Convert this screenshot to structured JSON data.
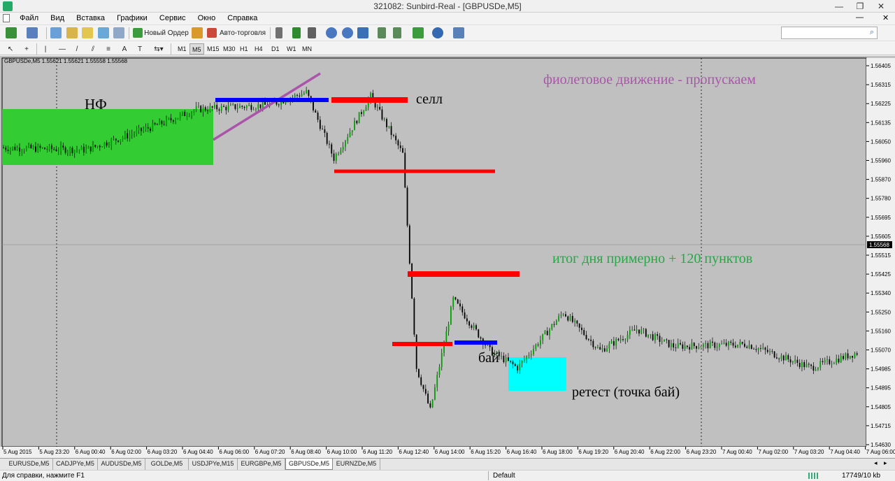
{
  "window": {
    "title": "321082: Sunbird-Real - [GBPUSDe,M5]",
    "minimize": "—",
    "restore": "❐",
    "close": "✕"
  },
  "menu": [
    "Файл",
    "Вид",
    "Вставка",
    "Графики",
    "Сервис",
    "Окно",
    "Справка"
  ],
  "toolbar": {
    "new_order": "Новый Ордер",
    "autotrading": "Авто-торговля",
    "search_placeholder": ""
  },
  "timeframes": [
    "M1",
    "M5",
    "M15",
    "M30",
    "H1",
    "H4",
    "D1",
    "W1",
    "MN"
  ],
  "active_timeframe": "M5",
  "chart": {
    "header": "GBPUSDe,M5  1.55621 1.55621 1.55558 1.55568",
    "current_price": "1.55568",
    "price_ticks": [
      "1.56405",
      "1.56315",
      "1.56225",
      "1.56135",
      "1.56050",
      "1.55960",
      "1.55870",
      "1.55780",
      "1.55695",
      "1.55605",
      "1.55515",
      "1.55425",
      "1.55340",
      "1.55250",
      "1.55160",
      "1.55070",
      "1.54985",
      "1.54895",
      "1.54805",
      "1.54715",
      "1.54630"
    ],
    "time_ticks": [
      "5 Aug 2015",
      "5 Aug 23:20",
      "6 Aug 00:40",
      "6 Aug 02:00",
      "6 Aug 03:20",
      "6 Aug 04:40",
      "6 Aug 06:00",
      "6 Aug 07:20",
      "6 Aug 08:40",
      "6 Aug 10:00",
      "6 Aug 11:20",
      "6 Aug 12:40",
      "6 Aug 14:00",
      "6 Aug 15:20",
      "6 Aug 16:40",
      "6 Aug 18:00",
      "6 Aug 19:20",
      "6 Aug 20:40",
      "6 Aug 22:00",
      "6 Aug 23:20",
      "7 Aug 00:40",
      "7 Aug 02:00",
      "7 Aug 03:20",
      "7 Aug 04:40",
      "7 Aug 06:00"
    ],
    "annotations": {
      "nf": "НФ",
      "sell": "селл",
      "buy": "бай",
      "violet": "фиолетовое движение - пропускаем",
      "result": "итог дня примерно + 120 пунктов",
      "retest": "ретест (точка бай)"
    },
    "colors": {
      "background": "#c0c0c0",
      "bull": "#00a000",
      "bear": "#000000",
      "nf_zone": "#33cc33",
      "retest_zone": "#00ffff",
      "level_red": "#ff0000",
      "level_blue": "#0000ff",
      "violet": "#aa55aa",
      "result_text": "#22aa44"
    }
  },
  "chart_data": {
    "type": "candlestick",
    "symbol": "GBPUSDe",
    "timeframe": "M5",
    "ylim": [
      1.5463,
      1.5645
    ],
    "anchors": [
      {
        "time": "5 Aug 23:00",
        "price": 1.5603
      },
      {
        "time": "6 Aug 02:00",
        "price": 1.5602
      },
      {
        "time": "6 Aug 04:40",
        "price": 1.5614
      },
      {
        "time": "6 Aug 06:00",
        "price": 1.5621
      },
      {
        "time": "6 Aug 08:40",
        "price": 1.5623
      },
      {
        "time": "6 Aug 10:00",
        "price": 1.5629
      },
      {
        "time": "6 Aug 11:00",
        "price": 1.5598
      },
      {
        "time": "6 Aug 12:20",
        "price": 1.5627
      },
      {
        "time": "6 Aug 13:30",
        "price": 1.56
      },
      {
        "time": "6 Aug 14:00",
        "price": 1.55
      },
      {
        "time": "6 Aug 14:30",
        "price": 1.548
      },
      {
        "time": "6 Aug 15:20",
        "price": 1.5532
      },
      {
        "time": "6 Aug 16:40",
        "price": 1.5508
      },
      {
        "time": "6 Aug 17:40",
        "price": 1.55
      },
      {
        "time": "6 Aug 19:20",
        "price": 1.5526
      },
      {
        "time": "6 Aug 20:40",
        "price": 1.5508
      },
      {
        "time": "6 Aug 22:00",
        "price": 1.5518
      },
      {
        "time": "6 Aug 23:20",
        "price": 1.551
      },
      {
        "time": "7 Aug 02:00",
        "price": 1.5511
      },
      {
        "time": "7 Aug 04:20",
        "price": 1.55
      },
      {
        "time": "7 Aug 06:00",
        "price": 1.5507
      }
    ],
    "levels": [
      {
        "kind": "blue",
        "price": 1.5625
      },
      {
        "kind": "red",
        "price": 1.5625
      },
      {
        "kind": "red",
        "price": 1.5592
      },
      {
        "kind": "red",
        "price": 1.5543
      },
      {
        "kind": "red",
        "price": 1.551
      },
      {
        "kind": "blue",
        "price": 1.5511
      }
    ]
  },
  "tabs": [
    "EURUSDe,M5",
    "CADJPYe,M5",
    "AUDUSDe,M5",
    "GOLDe,M5",
    "USDJPYe,M15",
    "EURGBPe,M5",
    "GBPUSDe,M5",
    "EURNZDe,M5"
  ],
  "active_tab": "GBPUSDe,M5",
  "status": {
    "help": "Для справки, нажмите F1",
    "profile": "Default",
    "traffic": "17749/10 kb"
  }
}
